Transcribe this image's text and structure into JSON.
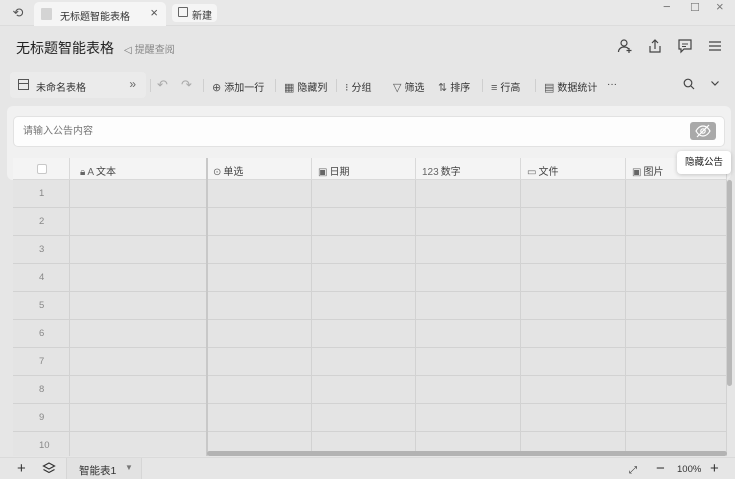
{
  "titlebar": {
    "tab_title": "无标题智能表格",
    "new_tab_label": "新建"
  },
  "header": {
    "doc_title": "无标题智能表格",
    "reminder_label": "提醒查阅"
  },
  "toolbar": {
    "sheet_name": "未命名表格",
    "add_row": "添加一行",
    "hide_cols": "隐藏列",
    "group": "分组",
    "filter": "筛选",
    "sort": "排序",
    "row_height": "行高",
    "stats": "数据统计",
    "more": "···"
  },
  "announcement": {
    "placeholder": "请输入公告内容",
    "hide_tooltip": "隐藏公告"
  },
  "grid": {
    "columns": [
      {
        "label": "文本",
        "icon": "text-icon"
      },
      {
        "label": "单选",
        "icon": "single-select-icon"
      },
      {
        "label": "日期",
        "icon": "date-icon"
      },
      {
        "label": "数字",
        "icon": "number-icon",
        "prefix": "123"
      },
      {
        "label": "文件",
        "icon": "folder-icon"
      },
      {
        "label": "图片",
        "icon": "image-icon"
      }
    ],
    "rows": [
      "1",
      "2",
      "3",
      "4",
      "5",
      "6",
      "7",
      "8",
      "9",
      "10"
    ]
  },
  "footer": {
    "sheet_tab": "智能表1",
    "zoom": "100%"
  }
}
